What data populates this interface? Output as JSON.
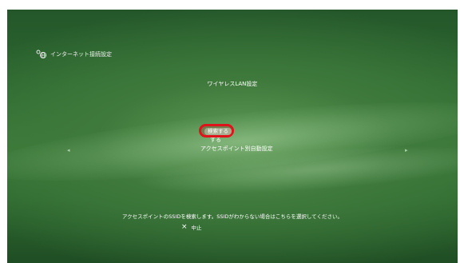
{
  "header": {
    "icon": "globe-network-icon",
    "title": "インターネット接続設定"
  },
  "subtitle": "ワイヤレスLAN設定",
  "menu": {
    "items": [
      {
        "label": "検索する",
        "selected": true
      },
      {
        "label": "する",
        "selected": false
      },
      {
        "label": "アクセスポイント別自動設定",
        "selected": false
      }
    ]
  },
  "nav": {
    "left_arrow": "◂",
    "right_arrow": "▸"
  },
  "help_text": "アクセスポイントのSSIDを検索します。SSIDがわからない場合はこちらを選択してください。",
  "footer": {
    "cancel_icon": "×",
    "cancel_label": "中止"
  },
  "colors": {
    "background": "#2e6b31",
    "highlight_ring": "#e0131a",
    "text": "#ffffff"
  }
}
